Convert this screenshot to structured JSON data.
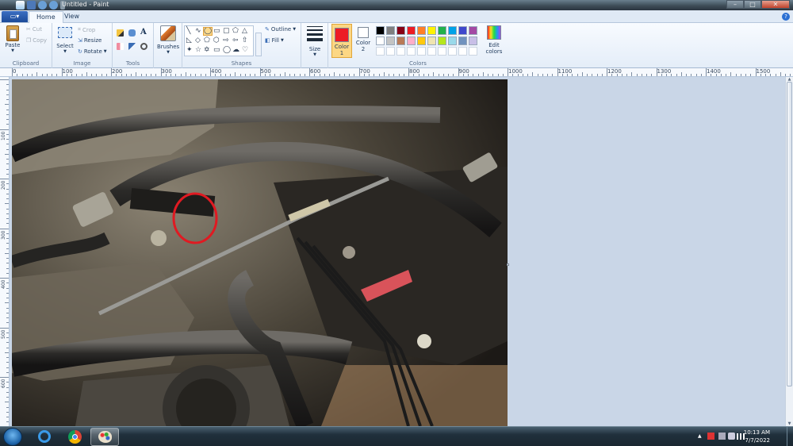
{
  "window": {
    "title": "Untitled - Paint",
    "minimize_glyph": "–",
    "maximize_glyph": "□",
    "close_glyph": "✕"
  },
  "tabs": {
    "file_icon": "▭▾",
    "home": "Home",
    "view": "View",
    "help": "?"
  },
  "ribbon": {
    "clipboard": {
      "paste": "Paste",
      "cut": "Cut",
      "copy": "Copy",
      "label": "Clipboard"
    },
    "image": {
      "select": "Select",
      "crop": "Crop",
      "resize": "Resize",
      "rotate": "Rotate",
      "label": "Image"
    },
    "tools": {
      "label": "Tools",
      "text_glyph": "A"
    },
    "brushes": {
      "label": "Brushes"
    },
    "shapes": {
      "outline": "Outline",
      "fill": "Fill",
      "label": "Shapes"
    },
    "size": {
      "label": "Size"
    },
    "colors": {
      "color1": "Color",
      "color1_num": "1",
      "color2": "Color",
      "color2_num": "2",
      "edit": "Edit",
      "edit2": "colors",
      "label": "Colors",
      "color1_value": "#ed1c24",
      "color2_value": "#ffffff",
      "palette_row1": [
        "#000000",
        "#7f7f7f",
        "#880015",
        "#ed1c24",
        "#ff7f27",
        "#fff200",
        "#22b14c",
        "#00a2e8",
        "#3f48cc",
        "#a349a4"
      ],
      "palette_row2": [
        "#ffffff",
        "#c3c3c3",
        "#b97a57",
        "#ffaec9",
        "#ffc90e",
        "#efe4b0",
        "#b5e61d",
        "#99d9ea",
        "#7092be",
        "#c8bfe7"
      ]
    }
  },
  "ruler": {
    "h_labels": [
      "0",
      "100",
      "200",
      "300",
      "400",
      "500",
      "600",
      "700",
      "800",
      "900",
      "1000",
      "1100",
      "1200",
      "1300",
      "1400",
      "1500"
    ],
    "v_labels": [
      "100",
      "200",
      "300",
      "400",
      "500",
      "600"
    ]
  },
  "taskbar": {
    "time": "10:13 AM",
    "date": "7/7/2022"
  }
}
